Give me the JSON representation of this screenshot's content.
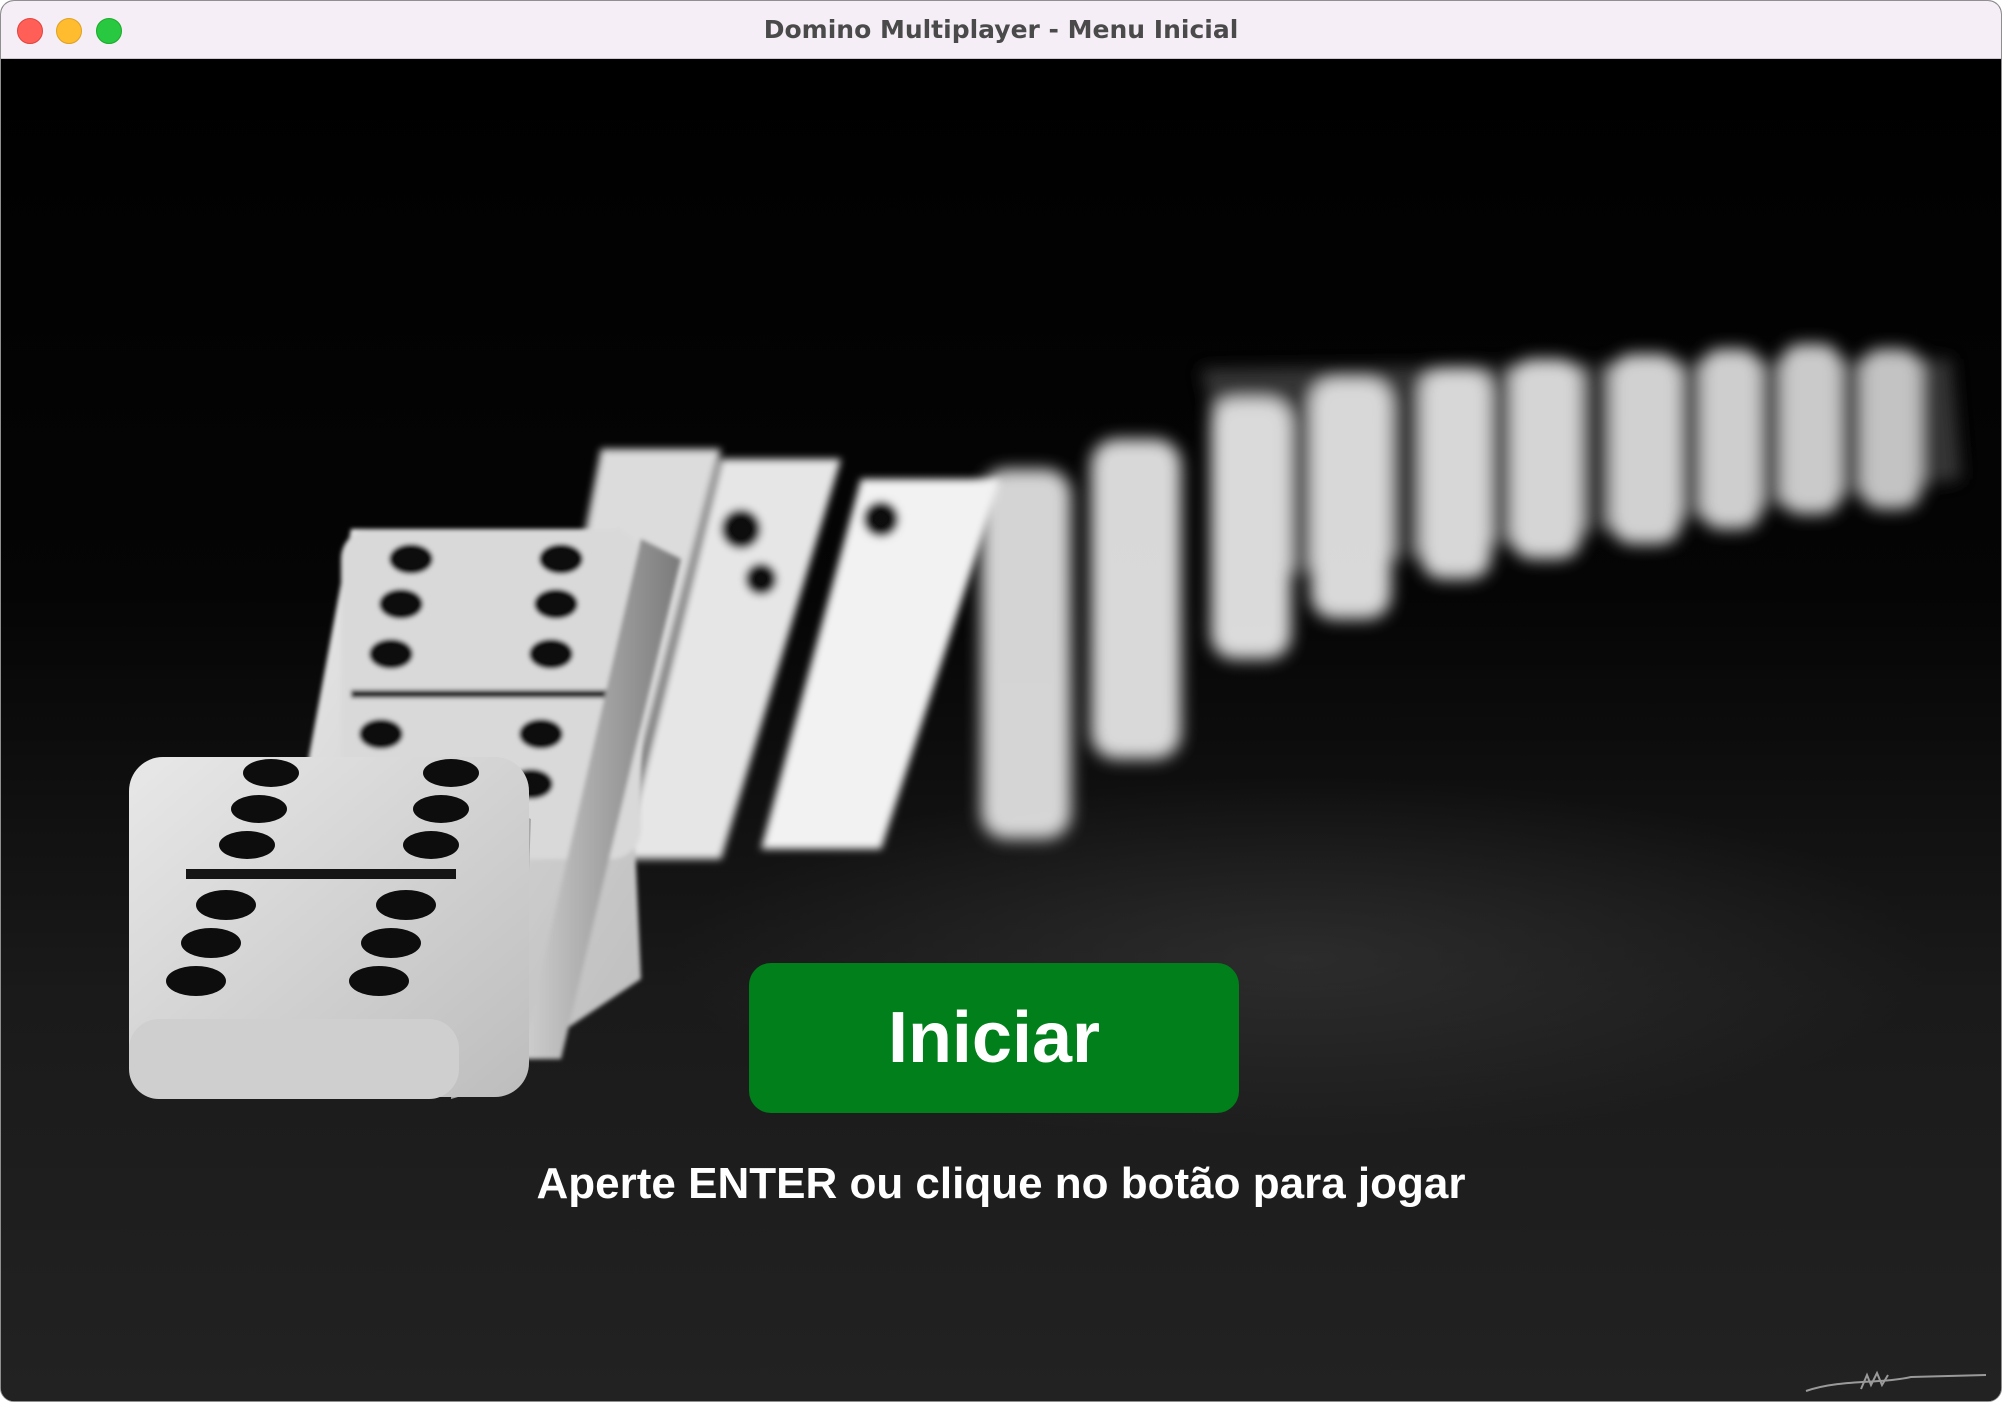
{
  "window": {
    "title": "Domino Multiplayer - Menu Inicial"
  },
  "menu": {
    "start_button_label": "Iniciar",
    "hint": "Aperte ENTER ou clique no botão para jogar"
  },
  "colors": {
    "start_button": "#007f1a",
    "titlebar": "#f5eef6",
    "background": "#000000"
  },
  "icons": {
    "close": "close-icon",
    "minimize": "minimize-icon",
    "maximize": "maximize-icon"
  }
}
